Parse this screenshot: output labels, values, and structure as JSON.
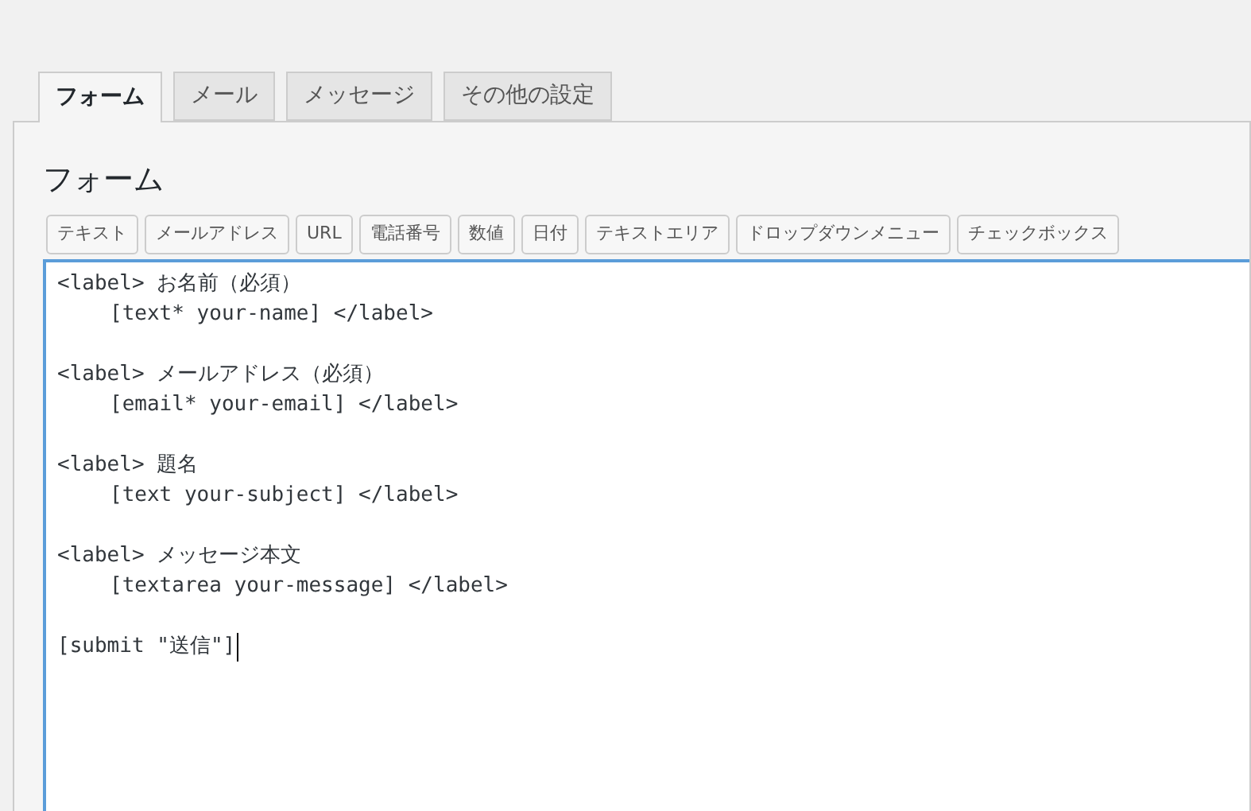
{
  "tabs": [
    {
      "label": "フォーム",
      "selected": true
    },
    {
      "label": "メール",
      "selected": false
    },
    {
      "label": "メッセージ",
      "selected": false
    },
    {
      "label": "その他の設定",
      "selected": false
    }
  ],
  "panel": {
    "heading": "フォーム",
    "tag_buttons": [
      "テキスト",
      "メールアドレス",
      "URL",
      "電話番号",
      "数値",
      "日付",
      "テキストエリア",
      "ドロップダウンメニュー",
      "チェックボックス"
    ],
    "editor": {
      "blocks": [
        {
          "label_line": "<label> お名前（必須）",
          "tag_line": "[text* your-name] </label>"
        },
        {
          "label_line": "<label> メールアドレス（必須）",
          "tag_line": "[email* your-email] </label>"
        },
        {
          "label_line": "<label> 題名",
          "tag_line": "[text your-subject] </label>"
        },
        {
          "label_line": "<label> メッセージ本文",
          "tag_line": "[textarea your-message] </label>"
        }
      ],
      "last_line": "[submit \"送信\"]",
      "focused": true
    }
  }
}
